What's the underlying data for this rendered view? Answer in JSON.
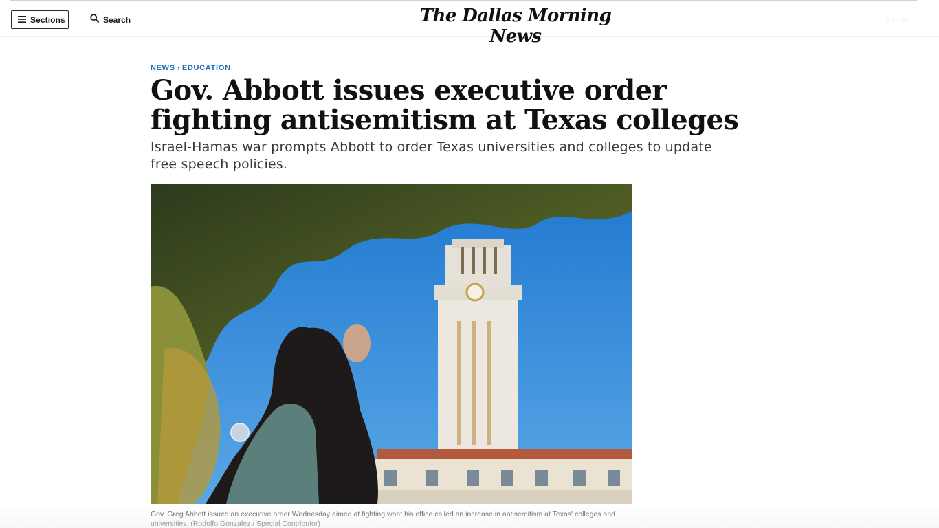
{
  "header": {
    "sections_label": "Sections",
    "search_label": "Search",
    "masthead": "The Dallas Morning News",
    "signin_label": "Sign in"
  },
  "breadcrumb": {
    "section": "NEWS",
    "subsection": "EDUCATION"
  },
  "article": {
    "headline": "Gov. Abbott issues executive order fighting antisemitism at Texas colleges",
    "dek": "Israel-Hamas war prompts Abbott to order Texas universities and colleges to update free speech policies.",
    "caption": "Gov. Greg Abbott issued an executive order Wednesday aimed at fighting what his office called an increase in antisemitism at Texas' colleges and universities. (Rodolfo Gonzalez / Special Contributor)"
  },
  "colors": {
    "link_blue": "#1e6fb8",
    "sky": "#2f86d6",
    "tower": "#e9e6df",
    "roof": "#b45a3c"
  },
  "icons": {
    "menu": "hamburger-icon",
    "search": "search-icon",
    "breadcrumb_separator": "chevron-right-icon"
  }
}
